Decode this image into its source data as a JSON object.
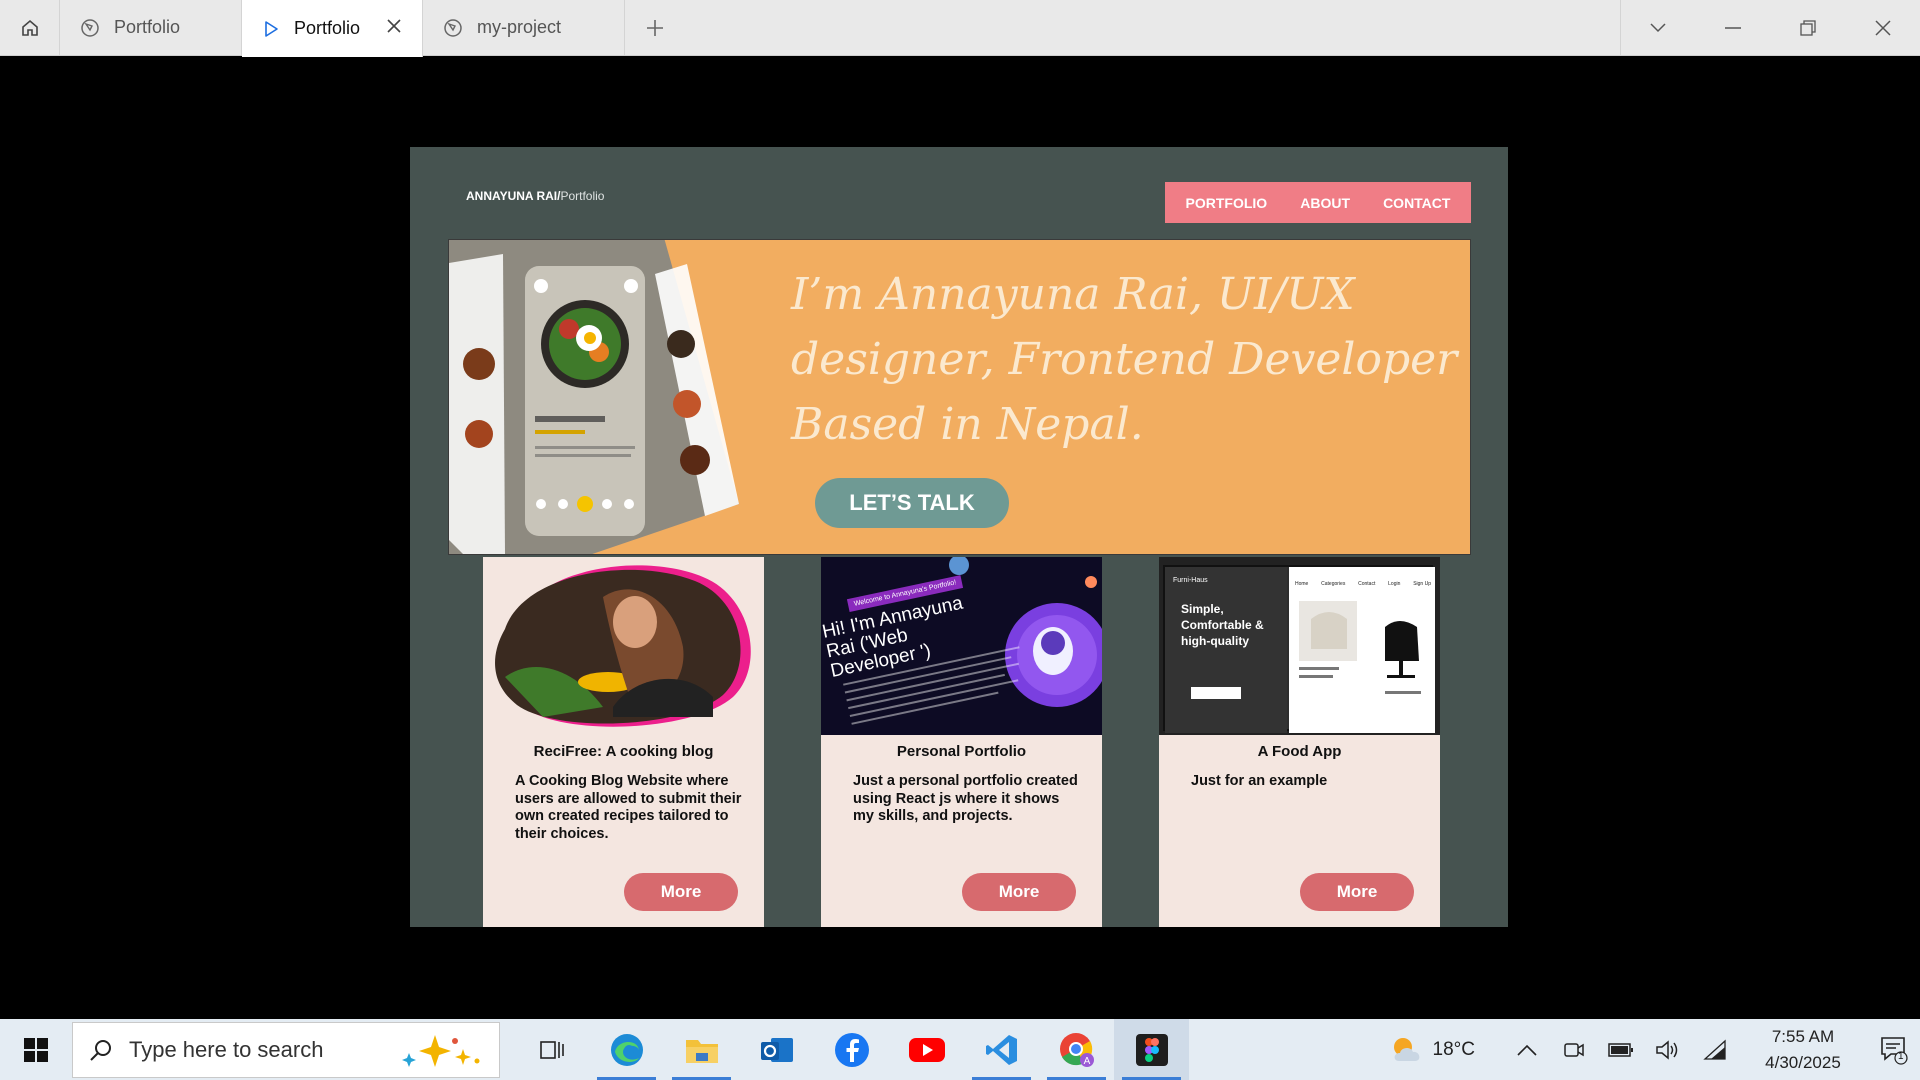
{
  "tabs": [
    {
      "label": "Portfolio",
      "active": false
    },
    {
      "label": "Portfolio",
      "active": true
    },
    {
      "label": "my-project",
      "active": false
    }
  ],
  "site": {
    "brand_bold": "ANNAYUNA RAI/",
    "brand_light": "Portfolio",
    "nav": [
      "PORTFOLIO",
      "ABOUT",
      "CONTACT"
    ],
    "hero_text": "I’m Annayuna Rai,  UI/UX designer, Frontend Developer Based in Nepal.",
    "cta": "LET’S TALK",
    "accent": "#f07d86",
    "hero_bg": "#f2ad60",
    "cards": [
      {
        "title": "ReciFree: A cooking blog",
        "desc": "A Cooking Blog Website where users are allowed to submit their own created recipes tailored to their choices.",
        "button": "More"
      },
      {
        "title": "Personal Portfolio",
        "desc": "Just a personal portfolio created using React js where it shows my skills, and projects.",
        "button": "More",
        "thumb_badge": "Welcome to Annayuna's Portfolio!",
        "thumb_heading": "Hi! I'm Annayuna Rai ('Web Developer ')"
      },
      {
        "title": "A Food App",
        "desc": "Just for an example",
        "button": "More",
        "thumb_brand": "Furni-Haus",
        "thumb_heading": "Simple, Comfortable & high-quality",
        "thumb_nav": [
          "Home",
          "Categories",
          "Contact",
          "Login",
          "Sign Up"
        ]
      }
    ]
  },
  "taskbar": {
    "search_placeholder": "Type here to search",
    "weather": "18°C",
    "time": "7:55 AM",
    "date": "4/30/2025",
    "notifications": "1"
  }
}
